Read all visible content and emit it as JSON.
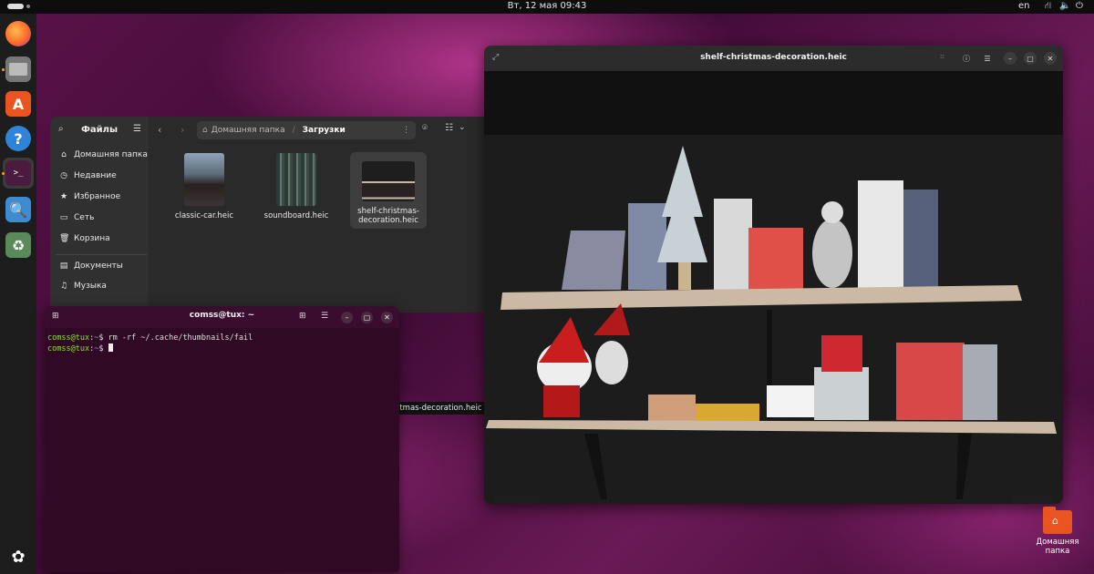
{
  "topbar": {
    "clock": "Вт, 12 мая  09:43",
    "lang": "en"
  },
  "dock": {
    "items": [
      "firefox-icon",
      "files-icon",
      "app-center-icon",
      "help-icon",
      "terminal-icon",
      "image-viewer-icon",
      "trash-icon",
      "show-apps-icon"
    ]
  },
  "files": {
    "sidebar_title": "Файлы",
    "sidebar": [
      {
        "label": "Домашняя папка",
        "icon": "home-icon"
      },
      {
        "label": "Недавние",
        "icon": "clock-icon"
      },
      {
        "label": "Избранное",
        "icon": "star-icon"
      },
      {
        "label": "Сеть",
        "icon": "network-icon"
      },
      {
        "label": "Корзина",
        "icon": "trash-icon"
      },
      {
        "label": "Документы",
        "icon": "document-icon"
      },
      {
        "label": "Музыка",
        "icon": "music-icon"
      }
    ],
    "path": {
      "home": "Домашняя папка",
      "current": "Загрузки"
    },
    "items": [
      {
        "name": "classic-car.heic"
      },
      {
        "name": "soundboard.heic"
      },
      {
        "name": "shelf-christmas-decoration.heic",
        "line1": "shelf-christmas-",
        "line2": "decoration.heic"
      }
    ],
    "tooltip": "shelf-christmas-decoration.heic"
  },
  "terminal": {
    "title": "comss@tux: ~",
    "user": "comss@tux",
    "path": "~",
    "command": "rm -rf ~/.cache/thumbnails/fail"
  },
  "viewer": {
    "title": "shelf-christmas-decoration.heic"
  },
  "desktop": {
    "home_label_1": "Домашняя",
    "home_label_2": "папка"
  }
}
